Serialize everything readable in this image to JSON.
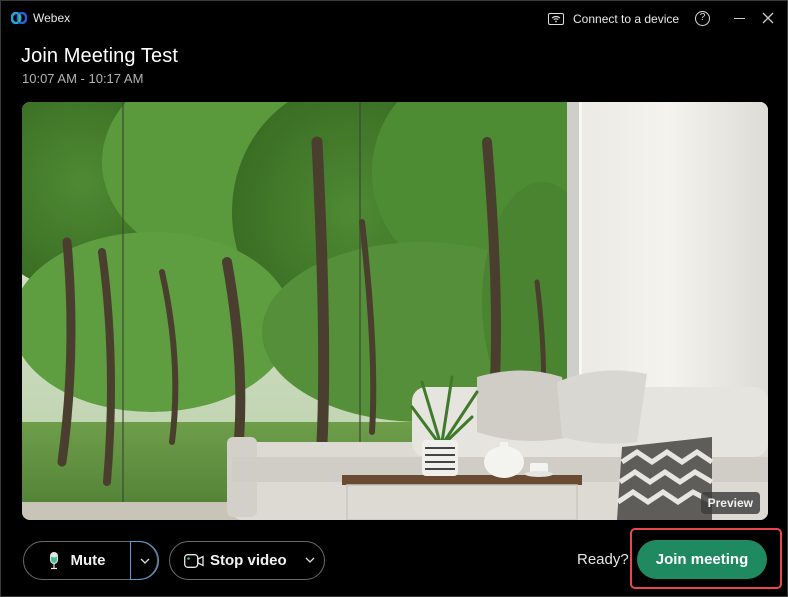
{
  "app": {
    "name": "Webex",
    "logo_colors": [
      "#1aa8e0",
      "#2f5bd8",
      "#36c48a"
    ]
  },
  "titlebar": {
    "connect_label": "Connect to a device",
    "connect_icon": "wireless-display-icon",
    "help_symbol": "?",
    "minimize_icon": "minimize-icon",
    "close_icon": "close-icon"
  },
  "meeting": {
    "title": "Join Meeting Test",
    "time_range": "10:07 AM - 10:17 AM"
  },
  "preview": {
    "badge": "Preview",
    "scene": "virtual-background-living-room-forest"
  },
  "controls": {
    "mute_label": "Mute",
    "mute_icon": "microphone-icon",
    "mute_icon_color": "#3fc49a",
    "audio_options_icon": "chevron-down-icon",
    "video_label": "Stop video",
    "video_icon": "camera-icon",
    "video_options_icon": "chevron-down-icon",
    "ready_text": "Ready?",
    "join_label": "Join meeting",
    "join_color": "#1f8a60",
    "highlight_color": "#e8484a"
  }
}
